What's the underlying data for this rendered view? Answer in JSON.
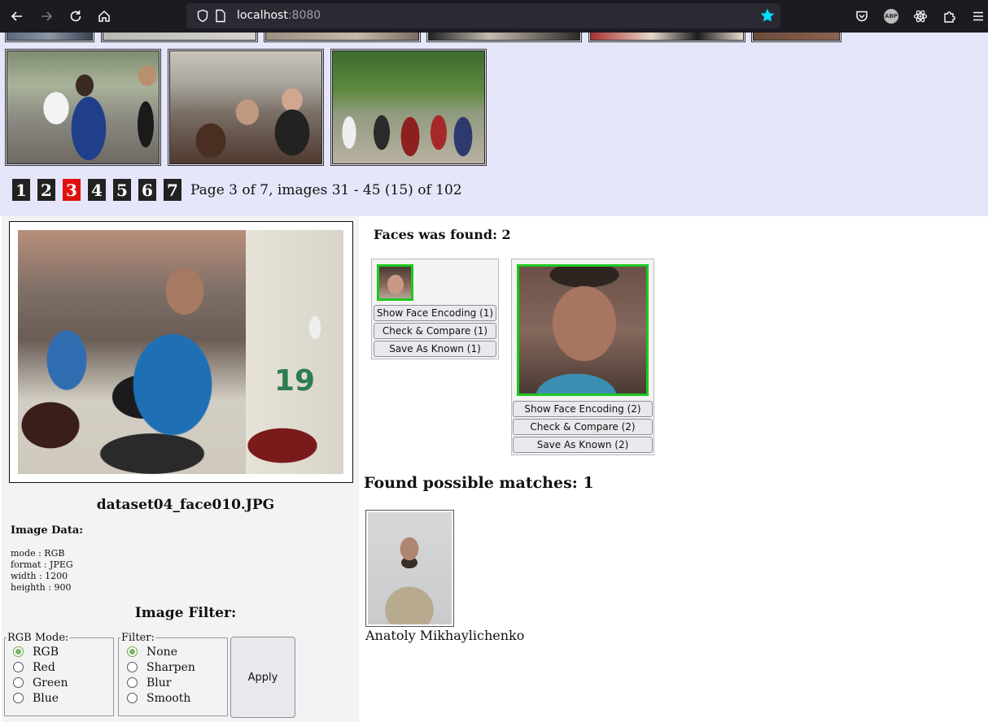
{
  "browser": {
    "url_host": "localhost",
    "url_port": ":8080"
  },
  "pagination": {
    "pages": [
      "1",
      "2",
      "3",
      "4",
      "5",
      "6",
      "7"
    ],
    "active_page": "3",
    "info": "Page 3 of 7, images 31 - 45 (15) of 102"
  },
  "image": {
    "filename": "dataset04_face010.JPG",
    "data_title": "Image Data:",
    "data_lines": [
      "mode : RGB",
      "format : JPEG",
      "width : 1200",
      "heighth : 900"
    ]
  },
  "filter": {
    "title": "Image Filter:",
    "rgb_legend": "RGB Mode:",
    "rgb_options": [
      "RGB",
      "Red",
      "Green",
      "Blue"
    ],
    "rgb_selected": "RGB",
    "filter_legend": "Filter:",
    "filter_options": [
      "None",
      "Sharpen",
      "Blur",
      "Smooth"
    ],
    "filter_selected": "None",
    "apply_label": "Apply"
  },
  "faces": {
    "title": "Faces was found: 2",
    "cards": [
      {
        "show_encoding": "Show Face Encoding (1)",
        "check_compare": "Check & Compare (1)",
        "save_known": "Save As Known (1)"
      },
      {
        "show_encoding": "Show Face Encoding (2)",
        "check_compare": "Check & Compare (2)",
        "save_known": "Save As Known (2)"
      }
    ]
  },
  "matches": {
    "title": "Found possible matches: 1",
    "items": [
      {
        "name": "Anatoly Mikhaylichenko"
      }
    ]
  },
  "colors": {
    "gallery_bg": "#e6e6fa",
    "active_page": "#e01010",
    "face_box": "#1ec81e"
  }
}
